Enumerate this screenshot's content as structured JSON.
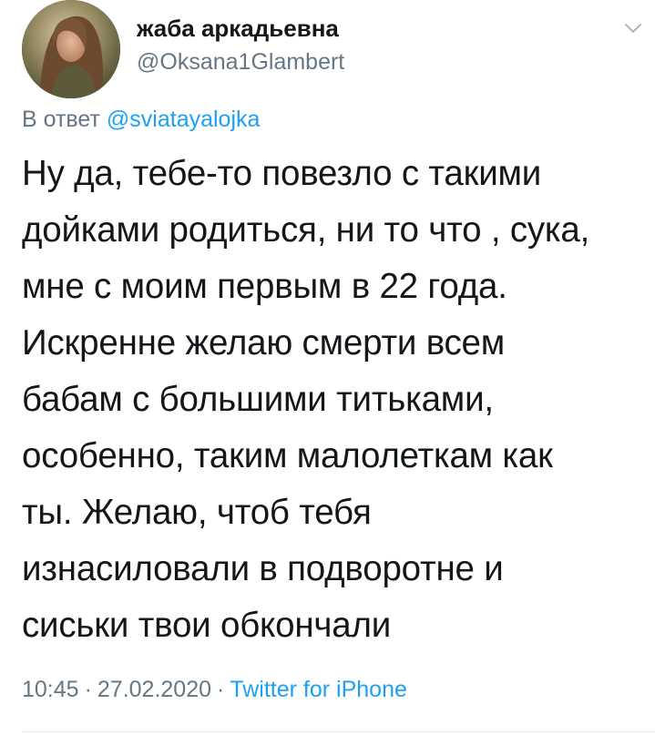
{
  "author": {
    "display_name": "жаба аркадьевна",
    "handle": "@Oksana1Glambert",
    "avatar_icon": "profile-photo"
  },
  "reply": {
    "prefix": "В ответ",
    "mention": "@sviatayalojka"
  },
  "tweet": {
    "lines": [
      "Ну да, тебе-то повезло с такими",
      "дойками родиться, ни то что , сука,",
      "мне с моим первым в 22 года.",
      "Искренне желаю смерти всем",
      "бабам с большими титьками,",
      "особенно, таким малолеткам как",
      "ты. Желаю, чтоб тебя",
      "изнасиловали в подворотне и",
      "сиськи твои обкончали"
    ]
  },
  "meta": {
    "time": "10:45",
    "date": "27.02.2020",
    "separator": "·",
    "source": "Twitter for iPhone"
  },
  "colors": {
    "text": "#14171a",
    "secondary": "#657786",
    "link": "#1da1f2",
    "divider": "#e1e8ed"
  },
  "icons": {
    "menu": "chevron-down-icon"
  }
}
